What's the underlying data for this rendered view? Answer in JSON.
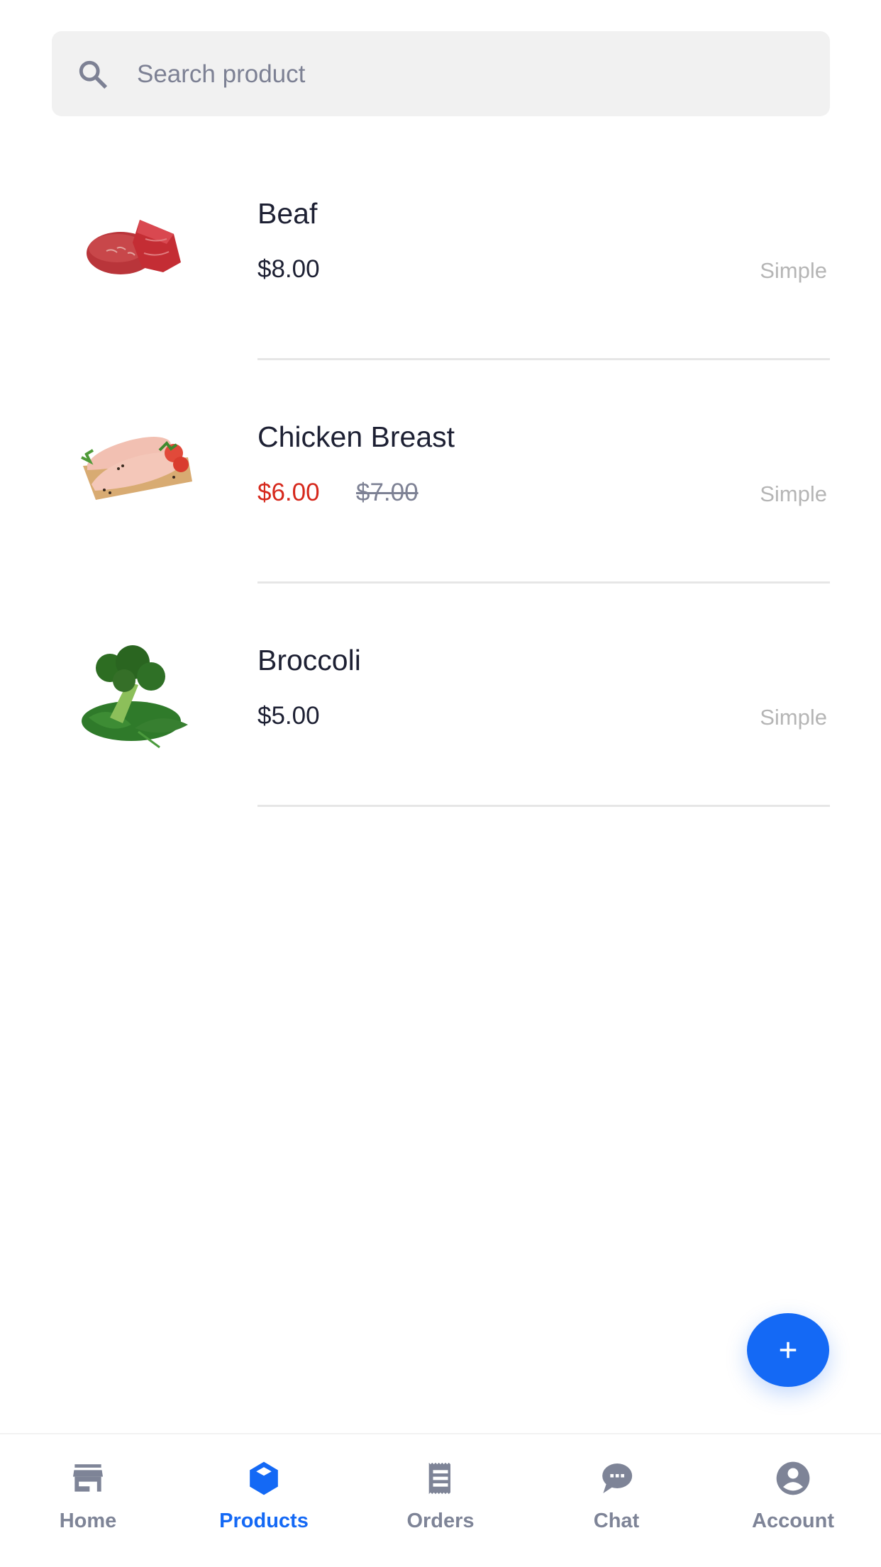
{
  "search": {
    "placeholder": "Search product",
    "value": ""
  },
  "products": [
    {
      "name": "Beaf",
      "price": "$8.00",
      "old_price": null,
      "on_sale": false,
      "type": "Simple",
      "image": "beef-image"
    },
    {
      "name": "Chicken Breast",
      "price": "$6.00",
      "old_price": "$7.00",
      "on_sale": true,
      "type": "Simple",
      "image": "chicken-breast-image"
    },
    {
      "name": "Broccoli",
      "price": "$5.00",
      "old_price": null,
      "on_sale": false,
      "type": "Simple",
      "image": "broccoli-image"
    }
  ],
  "fab": {
    "icon": "plus-icon",
    "label": "+"
  },
  "nav": {
    "active": "products",
    "items": [
      {
        "id": "home",
        "label": "Home",
        "icon": "storefront-icon"
      },
      {
        "id": "products",
        "label": "Products",
        "icon": "box-icon"
      },
      {
        "id": "orders",
        "label": "Orders",
        "icon": "receipt-icon"
      },
      {
        "id": "chat",
        "label": "Chat",
        "icon": "chat-bubble-icon"
      },
      {
        "id": "account",
        "label": "Account",
        "icon": "account-circle-icon"
      }
    ]
  },
  "colors": {
    "accent": "#1469f5",
    "sale": "#d6281c",
    "text_primary": "#1d2033",
    "text_muted": "#7d8194",
    "type_label": "#b5b5b5",
    "search_bg": "#f1f1f1"
  }
}
